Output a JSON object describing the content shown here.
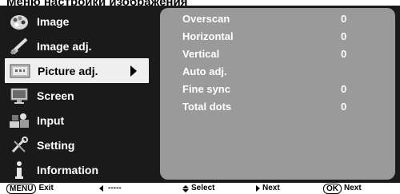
{
  "title": "Меню настройки изображения",
  "sidebar": {
    "items": [
      {
        "label": "Image",
        "icon": "palette-icon"
      },
      {
        "label": "Image adj.",
        "icon": "brush-icon"
      },
      {
        "label": "Picture adj.",
        "icon": "picture-adjust-icon",
        "selected": true
      },
      {
        "label": "Screen",
        "icon": "monitor-icon"
      },
      {
        "label": "Input",
        "icon": "input-device-icon"
      },
      {
        "label": "Setting",
        "icon": "wrench-icon"
      },
      {
        "label": "Information",
        "icon": "info-icon"
      }
    ]
  },
  "panel": {
    "rows": [
      {
        "label": "Overscan",
        "value": "0"
      },
      {
        "label": "Horizontal",
        "value": "0"
      },
      {
        "label": "Vertical",
        "value": "0"
      },
      {
        "label": "Auto adj.",
        "value": ""
      },
      {
        "label": "Fine sync",
        "value": "0"
      },
      {
        "label": "Total dots",
        "value": "0"
      }
    ]
  },
  "footer": {
    "menu_key": "MENU",
    "exit": "Exit",
    "back": "-----",
    "select": "Select",
    "next": "Next",
    "ok_key": "OK",
    "ok_next": "Next"
  },
  "colors": {
    "osd_background": "#1a1a1a",
    "panel_background": "#9a9a9a",
    "selected_item": "#efefef"
  }
}
